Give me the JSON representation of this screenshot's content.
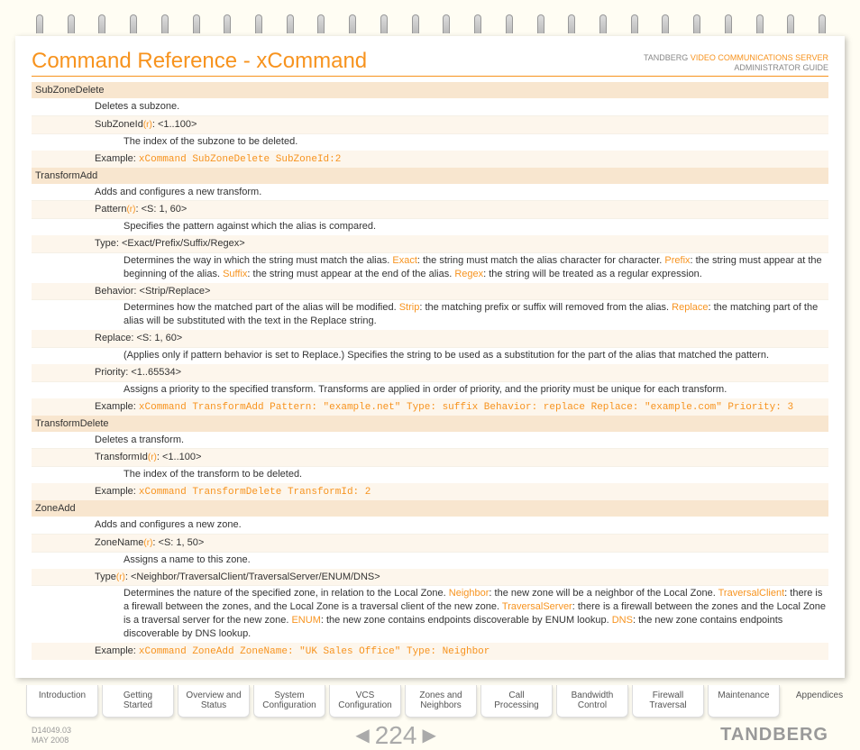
{
  "header": {
    "title": "Command Reference - xCommand",
    "right_line1_a": "TANDBERG ",
    "right_line1_b": "VIDEO COMMUNICATIONS SERVER",
    "right_line2": "ADMINISTRATOR GUIDE"
  },
  "sections": [
    {
      "name": "SubZoneDelete",
      "desc": "Deletes a subzone.",
      "params": [
        {
          "label_a": "SubZoneId",
          "label_r": "(r)",
          "label_b": ": <1..100>",
          "body": "The index of the subzone to be deleted."
        }
      ],
      "example_label": "Example:  ",
      "example_code": "xCommand SubZoneDelete SubZoneId:2"
    },
    {
      "name": "TransformAdd",
      "desc": "Adds and configures a new transform.",
      "params": [
        {
          "label_a": "Pattern",
          "label_r": "(r)",
          "label_b": ": <S: 1, 60>",
          "body": "Specifies the pattern against which the alias is compared."
        },
        {
          "label_a": "Type: <Exact/Prefix/Suffix/Regex>",
          "label_r": "",
          "label_b": "",
          "body_parts": [
            {
              "t": "Determines the way in which the string must match the alias. "
            },
            {
              "o": "Exact"
            },
            {
              "t": ": the string must match the alias character for character. "
            },
            {
              "o": "Prefix"
            },
            {
              "t": ": the string must appear at the beginning of the alias. "
            },
            {
              "o": "Suffix"
            },
            {
              "t": ": the string must appear at the end of the alias. "
            },
            {
              "o": "Regex"
            },
            {
              "t": ": the string will be treated as a regular expression."
            }
          ]
        },
        {
          "label_a": "Behavior: <Strip/Replace>",
          "label_r": "",
          "label_b": "",
          "body_parts": [
            {
              "t": "Determines how the matched part of the alias will be modified. "
            },
            {
              "o": "Strip"
            },
            {
              "t": ": the matching prefix or suffix will removed from the alias. "
            },
            {
              "o": "Replace"
            },
            {
              "t": ": the matching part of the alias will be substituted with the text in the Replace string."
            }
          ]
        },
        {
          "label_a": "Replace: <S: 1, 60>",
          "label_r": "",
          "label_b": "",
          "body": "(Applies only if pattern behavior is set to Replace.) Specifies the string to be used as a substitution for the part of the alias that matched the pattern."
        },
        {
          "label_a": "Priority: <1..65534>",
          "label_r": "",
          "label_b": "",
          "body": "Assigns a priority to the specified transform. Transforms are applied in order of priority, and the priority must be unique for each transform."
        }
      ],
      "example_label": "Example:  ",
      "example_code": "xCommand TransformAdd Pattern: \"example.net\" Type: suffix Behavior: replace Replace: \"example.com\" Priority: 3"
    },
    {
      "name": "TransformDelete",
      "desc": "Deletes a transform.",
      "params": [
        {
          "label_a": "TransformId",
          "label_r": "(r)",
          "label_b": ": <1..100>",
          "body": "The index of the transform to be deleted."
        }
      ],
      "example_label": "Example:  ",
      "example_code": "xCommand TransformDelete TransformId: 2"
    },
    {
      "name": "ZoneAdd",
      "desc": "Adds and configures a new zone.",
      "params": [
        {
          "label_a": "ZoneName",
          "label_r": "(r)",
          "label_b": ": <S: 1, 50>",
          "body": "Assigns a name to this zone."
        },
        {
          "label_a": "Type",
          "label_r": "(r)",
          "label_b": ": <Neighbor/TraversalClient/TraversalServer/ENUM/DNS>",
          "body_parts": [
            {
              "t": "Determines the nature of the specified zone, in relation to the Local Zone. "
            },
            {
              "o": "Neighbor"
            },
            {
              "t": ": the new zone will be a neighbor of the Local Zone. "
            },
            {
              "o": "TraversalClient"
            },
            {
              "t": ": there is a firewall between the zones, and the Local Zone is a traversal client of the new zone. "
            },
            {
              "o": "TraversalServer"
            },
            {
              "t": ": there is a firewall between the zones and the Local Zone is a traversal server for the new zone. "
            },
            {
              "o": "ENUM"
            },
            {
              "t": ": the new zone contains endpoints discoverable by ENUM lookup. "
            },
            {
              "o": "DNS"
            },
            {
              "t": ": the new zone contains endpoints discoverable by DNS lookup."
            }
          ]
        }
      ],
      "example_label": "Example:  ",
      "example_code": "xCommand ZoneAdd ZoneName: \"UK Sales Office\" Type: Neighbor"
    }
  ],
  "tabs": [
    "Introduction",
    "Getting Started",
    "Overview and\nStatus",
    "System\nConfiguration",
    "VCS\nConfiguration",
    "Zones and\nNeighbors",
    "Call\nProcessing",
    "Bandwidth\nControl",
    "Firewall\nTraversal",
    "Maintenance",
    "Appendices"
  ],
  "active_tab": 10,
  "footer": {
    "docid": "D14049.03",
    "date": "MAY 2008",
    "page": "224",
    "brand": "TANDBERG"
  }
}
